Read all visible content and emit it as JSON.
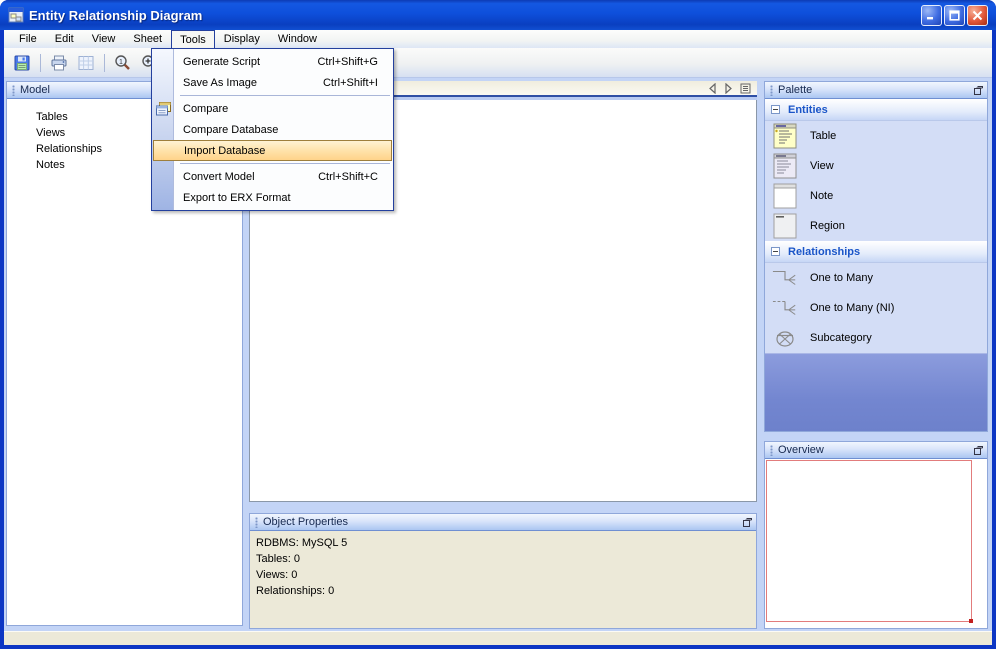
{
  "window": {
    "title": "Entity Relationship Diagram"
  },
  "menubar": {
    "items": [
      "File",
      "Edit",
      "View",
      "Sheet",
      "Tools",
      "Display",
      "Window"
    ],
    "open_item": "Tools"
  },
  "toolbar": {
    "buttons": [
      "save",
      "print",
      "grid",
      "zoom-actual",
      "zoom-in",
      "zoom-out"
    ]
  },
  "tools_menu": {
    "highlighted": "Import Database",
    "items": [
      {
        "label": "Generate Script",
        "shortcut": "Ctrl+Shift+G"
      },
      {
        "label": "Save As Image",
        "shortcut": "Ctrl+Shift+I"
      },
      {
        "label": "Compare",
        "shortcut": ""
      },
      {
        "label": "Compare Database",
        "shortcut": ""
      },
      {
        "label": "Import Database",
        "shortcut": ""
      },
      {
        "label": "Convert Model",
        "shortcut": "Ctrl+Shift+C"
      },
      {
        "label": "Export to ERX Format",
        "shortcut": ""
      }
    ]
  },
  "model_panel": {
    "title": "Model",
    "items": [
      "Tables",
      "Views",
      "Relationships",
      "Notes"
    ]
  },
  "palette": {
    "title": "Palette",
    "entities": {
      "title": "Entities",
      "items": [
        "Table",
        "View",
        "Note",
        "Region"
      ]
    },
    "relationships": {
      "title": "Relationships",
      "items": [
        "One to Many",
        "One to Many (NI)",
        "Subcategory"
      ]
    }
  },
  "overview": {
    "title": "Overview"
  },
  "object_properties": {
    "title": "Object Properties",
    "lines": [
      "RDBMS: MySQL 5",
      "Tables: 0",
      "Views: 0",
      "Relationships: 0"
    ]
  },
  "colors": {
    "titlebar_blue": "#0e4fdb",
    "menu_highlight": "#ffd38a",
    "accent_blue": "#1a55c8",
    "panel_beige": "#ece9d8",
    "workspace_blue": "#c3d4f6",
    "overview_viewport_red": "#e27c7c"
  }
}
